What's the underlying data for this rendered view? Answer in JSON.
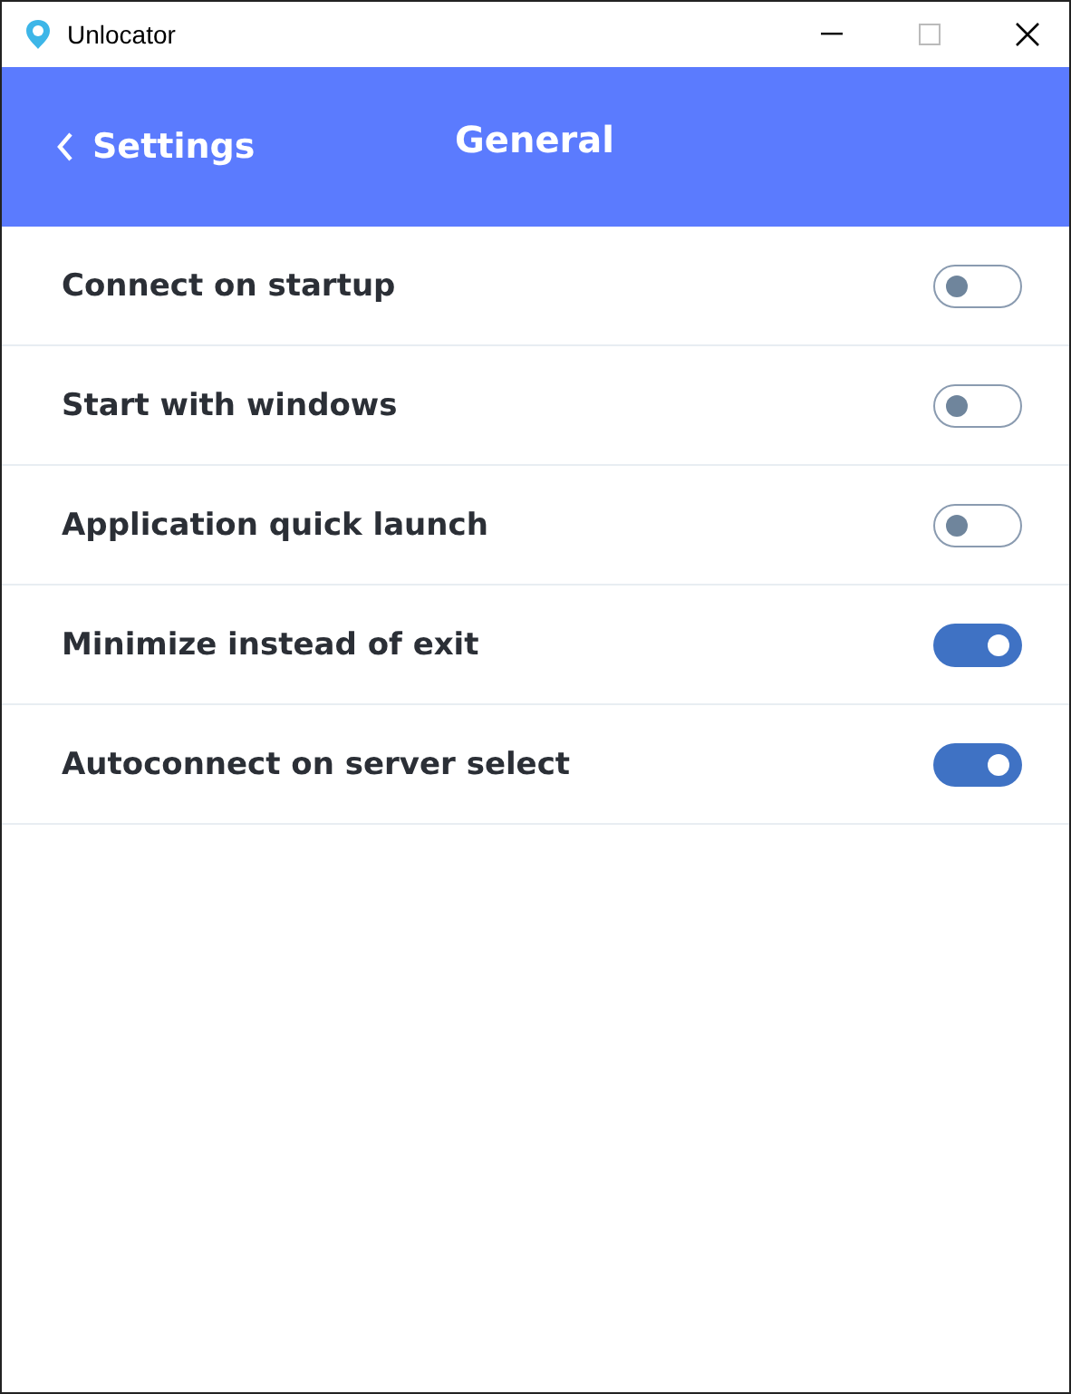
{
  "window": {
    "title": "Unlocator"
  },
  "header": {
    "back_label": "Settings",
    "title": "General"
  },
  "settings": [
    {
      "label": "Connect on startup",
      "on": false
    },
    {
      "label": "Start with windows",
      "on": false
    },
    {
      "label": "Application quick launch",
      "on": false
    },
    {
      "label": "Minimize instead of exit",
      "on": true
    },
    {
      "label": "Autoconnect on server select",
      "on": true
    }
  ]
}
